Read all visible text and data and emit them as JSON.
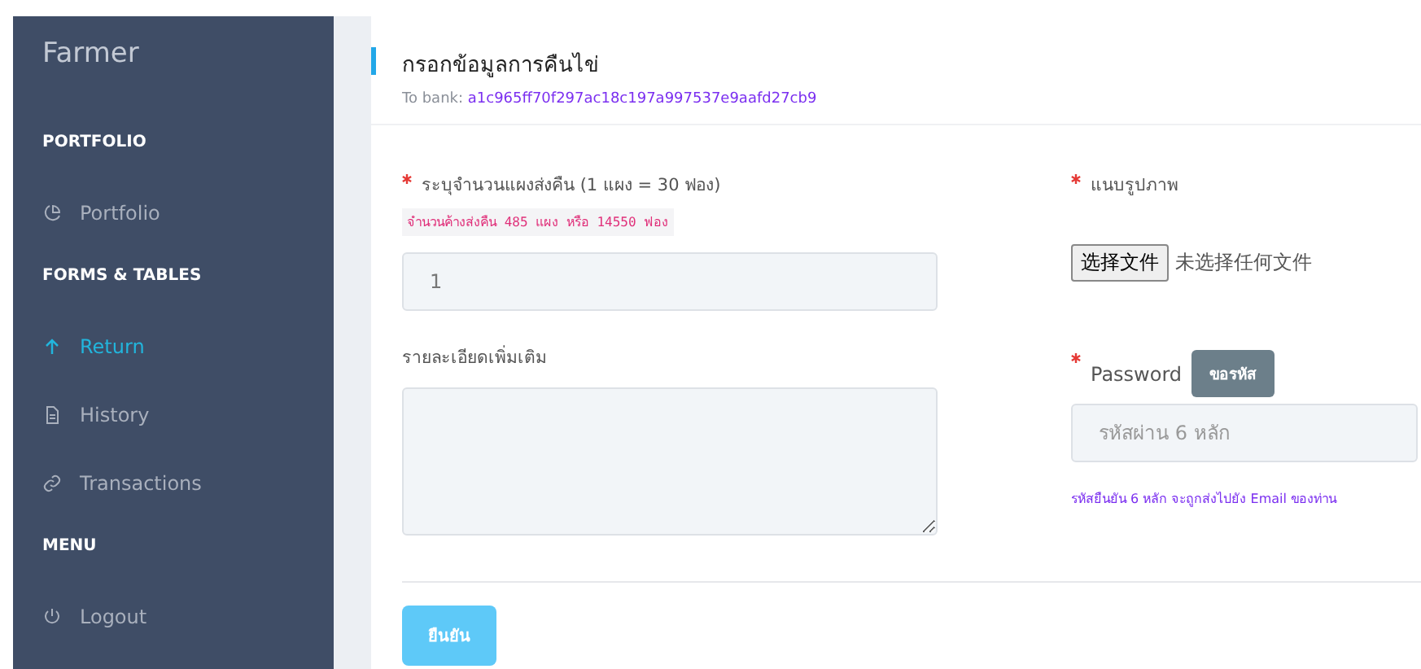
{
  "sidebar": {
    "brand": "Farmer",
    "sections": [
      {
        "heading": "PORTFOLIO",
        "items": [
          {
            "label": "Portfolio",
            "selected": false
          }
        ]
      },
      {
        "heading": "FORMS & TABLES",
        "items": [
          {
            "label": "Return",
            "selected": true
          },
          {
            "label": "History",
            "selected": false
          },
          {
            "label": "Transactions",
            "selected": false
          }
        ]
      },
      {
        "heading": "MENU",
        "items": [
          {
            "label": "Logout",
            "selected": false
          }
        ]
      }
    ]
  },
  "header": {
    "title": "กรอกข้อมูลการคืนไข่",
    "bank_label": "To bank:",
    "bank_address": "a1c965ff70f297ac18c197a997537e9aafd27cb9"
  },
  "form": {
    "quantity": {
      "required": true,
      "label": "ระบุจำนวนแผงส่งคืน (1 แผง = 30 ฟอง)",
      "note": "จำนวนค้างส่งคืน 485 แผง หรือ 14550 ฟอง",
      "value": "1"
    },
    "details": {
      "required": false,
      "label": "รายละเอียดเพิ่มเติม"
    },
    "image": {
      "required": true,
      "label": "แนบรูปภาพ",
      "button": "选择文件",
      "status": "未选择任何文件"
    },
    "password": {
      "required": true,
      "label": "Password",
      "request_button": "ขอรหัส",
      "placeholder": "รหัสผ่าน 6 หลัก",
      "hint": "รหัสยืนยัน 6 หลัก จะถูกส่งไปยัง Email ของท่าน"
    },
    "submit": "ยืนยัน"
  }
}
